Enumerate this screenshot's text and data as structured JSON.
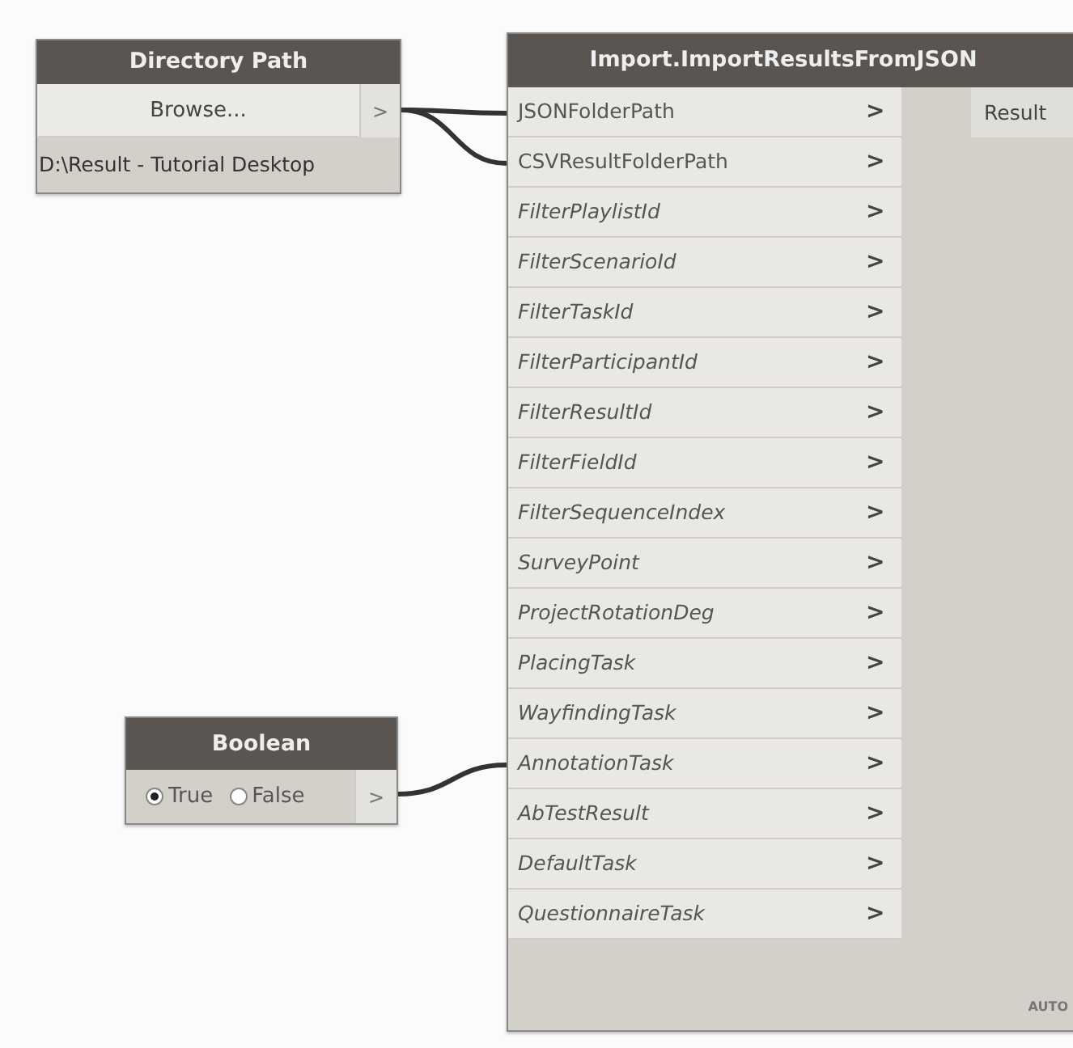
{
  "directory_node": {
    "title": "Directory Path",
    "button": "Browse...",
    "output": ">",
    "path": "D:\\Result - Tutorial Desktop"
  },
  "boolean_node": {
    "title": "Boolean",
    "options": [
      {
        "label": "True",
        "selected": true
      },
      {
        "label": "False",
        "selected": false
      }
    ],
    "output": ">"
  },
  "import_node": {
    "title": "Import.ImportResultsFromJSON",
    "inputs": [
      {
        "label": "JSONFolderPath",
        "optional": false,
        "connected": true,
        "arrow": ">"
      },
      {
        "label": "CSVResultFolderPath",
        "optional": false,
        "connected": true,
        "arrow": ">"
      },
      {
        "label": "FilterPlaylistId",
        "optional": true,
        "arrow": ">"
      },
      {
        "label": "FilterScenarioId",
        "optional": true,
        "arrow": ">"
      },
      {
        "label": "FilterTaskId",
        "optional": true,
        "arrow": ">"
      },
      {
        "label": "FilterParticipantId",
        "optional": true,
        "arrow": ">"
      },
      {
        "label": "FilterResultId",
        "optional": true,
        "arrow": ">"
      },
      {
        "label": "FilterFieldId",
        "optional": true,
        "arrow": ">"
      },
      {
        "label": "FilterSequenceIndex",
        "optional": true,
        "arrow": ">"
      },
      {
        "label": "SurveyPoint",
        "optional": true,
        "arrow": ">"
      },
      {
        "label": "ProjectRotationDeg",
        "optional": true,
        "arrow": ">"
      },
      {
        "label": "PlacingTask",
        "optional": true,
        "arrow": ">"
      },
      {
        "label": "WayfindingTask",
        "optional": true,
        "arrow": ">"
      },
      {
        "label": "AnnotationTask",
        "optional": true,
        "connected": true,
        "arrow": ">"
      },
      {
        "label": "AbTestResult",
        "optional": true,
        "arrow": ">"
      },
      {
        "label": "DefaultTask",
        "optional": true,
        "arrow": ">"
      },
      {
        "label": "QuestionnaireTask",
        "optional": true,
        "arrow": ">"
      }
    ],
    "output": "Result",
    "lacing": "AUTO"
  }
}
